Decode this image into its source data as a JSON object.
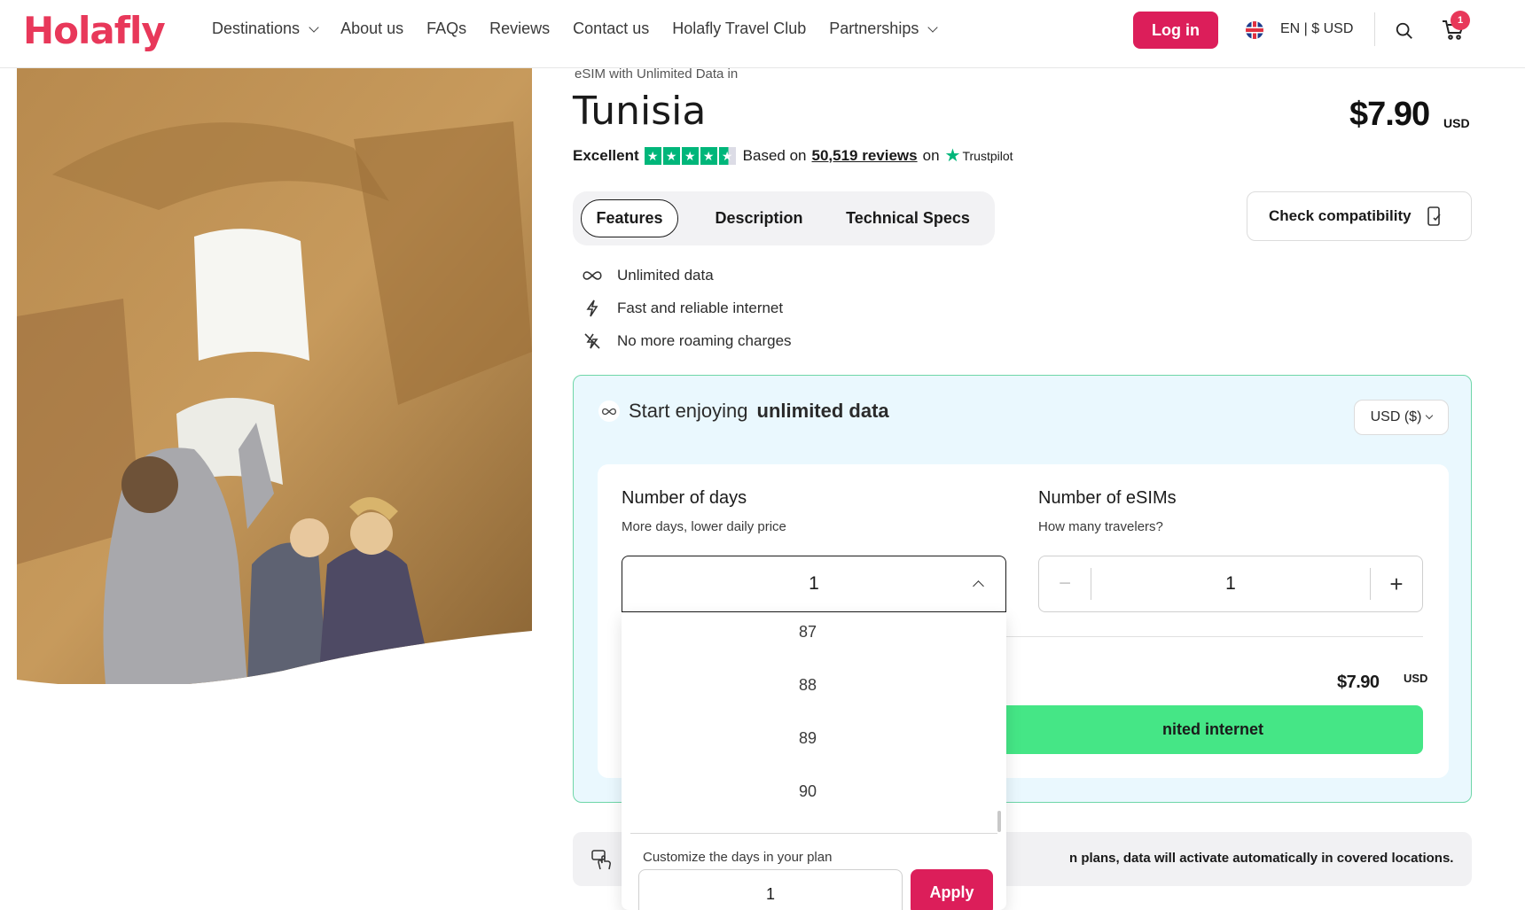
{
  "header": {
    "logo": "Holafly",
    "nav": [
      {
        "label": "Destinations",
        "has_dropdown": true
      },
      {
        "label": "About us",
        "has_dropdown": false
      },
      {
        "label": "FAQs",
        "has_dropdown": false
      },
      {
        "label": "Reviews",
        "has_dropdown": false
      },
      {
        "label": "Contact us",
        "has_dropdown": false
      },
      {
        "label": "Holafly Travel Club",
        "has_dropdown": false
      },
      {
        "label": "Partnerships",
        "has_dropdown": true
      }
    ],
    "login_label": "Log in",
    "lang_currency": "EN | $ USD",
    "cart_count": "1",
    "icons": {
      "flag": "uk-flag-icon",
      "search": "search-icon",
      "cart": "cart-icon"
    },
    "brand_color": "#e8385a"
  },
  "product": {
    "subtitle": "eSIM with Unlimited Data in",
    "title": "Tunisia",
    "price": "$7.90",
    "price_currency": "USD",
    "rating": {
      "word": "Excellent",
      "based_on": "Based on",
      "reviews_link": "50,519 reviews",
      "on": "on",
      "platform": "Trustpilot",
      "stars": 4.5,
      "star_color": "#00b67a"
    }
  },
  "tabs": [
    {
      "label": "Features",
      "active": true
    },
    {
      "label": "Description",
      "active": false
    },
    {
      "label": "Technical Specs",
      "active": false
    }
  ],
  "check_compatibility": {
    "label": "Check compatibility",
    "icon": "phone-check-icon"
  },
  "features": [
    {
      "label": "Unlimited data",
      "icon": "infinity-icon"
    },
    {
      "label": "Fast and reliable internet",
      "icon": "lightning-icon"
    },
    {
      "label": "No more roaming charges",
      "icon": "no-roaming-icon"
    }
  ],
  "plan": {
    "heading_prefix": "Start enjoying",
    "heading_bold": "unlimited data",
    "currency_select": "USD ($)",
    "days": {
      "title": "Number of days",
      "subtitle": "More days, lower daily price",
      "value": "1"
    },
    "esims": {
      "title": "Number of eSIMs",
      "subtitle": "How many travelers?",
      "value": "1",
      "minus": "−",
      "plus": "+"
    },
    "total": "$7.90",
    "total_currency": "USD",
    "buy_label_visible": "nited internet",
    "buy_color": "#45e686",
    "accent_border": "#6ed6a8"
  },
  "info_bar": {
    "text_visible": "n plans, data will activate automatically in covered locations.",
    "icon": "hand-tap-icon"
  },
  "dropdown": {
    "options": [
      "87",
      "88",
      "89",
      "90"
    ],
    "custom_label": "Customize the days in your plan",
    "custom_value": "1",
    "apply_label": "Apply",
    "apply_color": "#dc1e5a"
  }
}
